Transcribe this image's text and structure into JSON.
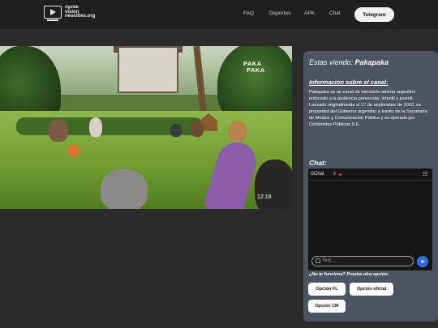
{
  "header": {
    "logo": {
      "line1": "rigolab",
      "line2": "vision",
      "line3": "neocities.org"
    },
    "nav": [
      "FAQ",
      "Deportes",
      "APK",
      "Chat"
    ],
    "telegram_label": "Telegram"
  },
  "player": {
    "channel_logo": [
      "PAKA",
      "PAKA"
    ],
    "timestamp": "12:18"
  },
  "sidebar": {
    "watching_prefix": "Estas viendo: ",
    "watching_channel": "Pakapaka",
    "info_title": "Informacion sobre el canal:",
    "info_text": "Pakapaka es un canal de televisión abierta argentino enfocado a la audiencia preescolar, infantil y juvenil. Lanzado originalmente el 17 de septiembre de 2010, es propiedad del Gobierno argentino a través de la Secretaría de Medios y Comunicación Pública y es operado por Contenidos Públicos S.E.",
    "chat_title": "Chat:",
    "chat": {
      "brand": "SChat",
      "online_count": "2",
      "input_placeholder": "Text...",
      "send_icon": "send-icon"
    },
    "fallback_prompt": "¿No te funciona? Prueba otra opción:",
    "options": [
      "Opción FL",
      "Opción oficial",
      "Opción CM"
    ]
  },
  "colors": {
    "page_bg": "#2b2b2b",
    "header_bg": "#1f1f1f",
    "panel_bg": "#4c5361",
    "send_button": "#2f6fe0",
    "online_dot": "#e23b3b"
  }
}
